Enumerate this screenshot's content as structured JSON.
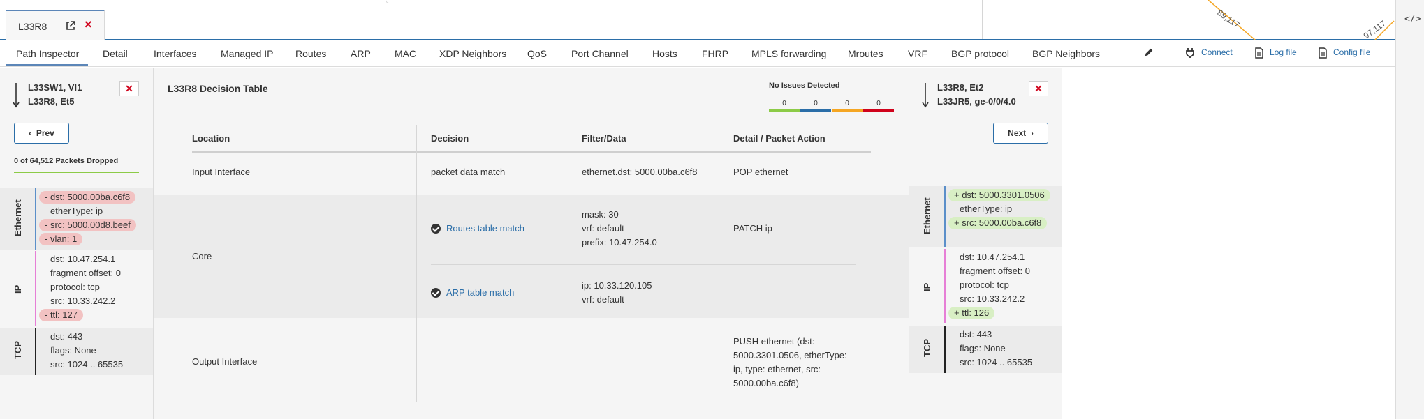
{
  "device_tab": {
    "label": "L33R8"
  },
  "topology": {
    "link_label_1": "89,117",
    "link_label_2": "97,117"
  },
  "nav": {
    "tabs": [
      "Path Inspector",
      "Detail",
      "Interfaces",
      "Managed IP",
      "Routes",
      "ARP",
      "MAC",
      "XDP Neighbors",
      "QoS",
      "Port Channel",
      "Hosts",
      "FHRP",
      "MPLS forwarding",
      "Mroutes",
      "VRF",
      "BGP protocol",
      "BGP Neighbors"
    ],
    "connect_label": "Connect",
    "log_file_label": "Log file",
    "config_file_label": "Config file"
  },
  "left_hop": {
    "line1": "L33SW1, Vl1",
    "line2": "L33R8, Et5",
    "close": "✕",
    "prev_label": "Prev",
    "dropped_text": "0 of 64,512 Packets Dropped",
    "ethernet": {
      "label": "Ethernet",
      "dst": "- dst: 5000.00ba.c6f8",
      "ether_type": "etherType: ip",
      "src": "- src: 5000.00d8.beef",
      "vlan": "- vlan: 1"
    },
    "ip": {
      "label": "IP",
      "dst": "dst: 10.47.254.1",
      "fragment_offset": "fragment offset: 0",
      "protocol": "protocol: tcp",
      "src": "src: 10.33.242.2",
      "ttl": "- ttl: 127"
    },
    "tcp": {
      "label": "TCP",
      "dst": "dst: 443",
      "flags": "flags: None",
      "src": "src: 1024 .. 65535"
    }
  },
  "decision_table": {
    "title": "L33R8 Decision Table",
    "issues_title": "No Issues Detected",
    "issue_counts": [
      {
        "value": "0",
        "color": "#8ccb47"
      },
      {
        "value": "0",
        "color": "#2b6ea8"
      },
      {
        "value": "0",
        "color": "#f5a623"
      },
      {
        "value": "0",
        "color": "#d0021b"
      }
    ],
    "columns": [
      "Location",
      "Decision",
      "Filter/Data",
      "Detail / Packet Action"
    ],
    "input": {
      "location": "Input Interface",
      "decision": "packet data match",
      "filter": "ethernet.dst: 5000.00ba.c6f8",
      "action": "POP ethernet"
    },
    "core": {
      "location": "Core",
      "routes": {
        "decision": "Routes table match",
        "filter_1": "mask: 30",
        "filter_2": "vrf: default",
        "filter_3": "prefix: 10.47.254.0",
        "action": "PATCH ip"
      },
      "arp": {
        "decision": "ARP table match",
        "filter_1": "ip: 10.33.120.105",
        "filter_2": "vrf: default"
      }
    },
    "output": {
      "location": "Output Interface",
      "action_1": "PUSH ethernet (dst:",
      "action_2": "5000.3301.0506, etherType:",
      "action_3": "ip, type: ethernet, src:",
      "action_4": "5000.00ba.c6f8)"
    }
  },
  "right_hop": {
    "line1": "L33R8, Et2",
    "line2": "L33JR5, ge-0/0/4.0",
    "close": "✕",
    "next_label": "Next",
    "ethernet": {
      "label": "Ethernet",
      "dst": "+ dst: 5000.3301.0506",
      "ether_type": "etherType: ip",
      "src": "+ src: 5000.00ba.c6f8"
    },
    "ip": {
      "label": "IP",
      "dst": "dst: 10.47.254.1",
      "fragment_offset": "fragment offset: 0",
      "protocol": "protocol: tcp",
      "src": "src: 10.33.242.2",
      "ttl": "+ ttl: 126"
    },
    "tcp": {
      "label": "TCP",
      "dst": "dst: 443",
      "flags": "flags: None",
      "src": "src: 1024 .. 65535"
    }
  },
  "colors": {
    "accent": "#2b6ea8",
    "ethernet_rule": "#5b8fc9",
    "ip_rule": "#e67fd6",
    "tcp_rule": "#222222",
    "removed": "#f2c2c2",
    "added": "#d8efc4"
  }
}
